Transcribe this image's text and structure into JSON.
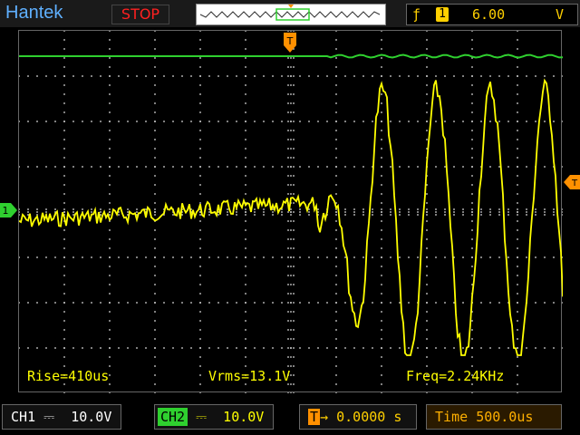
{
  "header": {
    "brand": "Hantek",
    "run_state": "STOP",
    "trigger_slope_icon": "rising-edge-icon",
    "trigger_channel": "1",
    "trigger_level": "6.00",
    "trigger_unit": "V"
  },
  "measurements": {
    "rise": "Rise=410us",
    "vrms": "Vrms=13.1V",
    "freq": "Freq=2.24KHz"
  },
  "status": {
    "ch1_label": "CH1",
    "ch1_coupling": "⎓",
    "ch1_scale": "10.0V",
    "ch2_label": "CH2",
    "ch2_coupling": "⎓",
    "ch2_scale": "10.0V",
    "trigger_icon": "T",
    "trigger_offset": "0.0000 s",
    "time_label": "Time",
    "time_scale": "500.0us"
  },
  "markers": {
    "trigger_position": "T",
    "ch1_ground": "1",
    "trigger_level": "T"
  },
  "colors": {
    "ch1": "#ffff00",
    "ch2": "#2fd02f",
    "grid": "#c8c8c8",
    "trigger": "#ff9000"
  }
}
